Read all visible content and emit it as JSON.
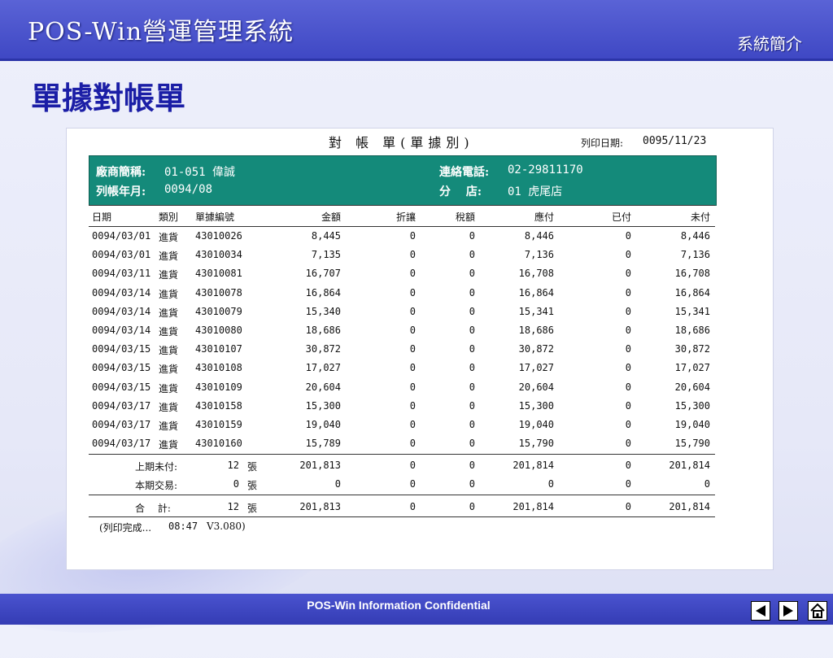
{
  "header": {
    "app_title": "POS-Win營運管理系統",
    "section": "系統簡介"
  },
  "page_heading": "單據對帳單",
  "report": {
    "title": "對 帳 單(單據別)",
    "print_date_label": "列印日期:",
    "print_date": "0095/11/23",
    "vendor_label": "廠商簡稱:",
    "vendor_value": "01-051 偉誠",
    "phone_label": "連絡電話:",
    "phone_value": "02-29811170",
    "period_label": "列帳年月:",
    "period_value": "0094/08",
    "branch_label": "分　 店:",
    "branch_value": "01 虎尾店",
    "columns": [
      "日期",
      "類別",
      "單據編號",
      "金額",
      "折讓",
      "稅額",
      "應付",
      "已付",
      "未付"
    ],
    "rows": [
      [
        "0094/03/01",
        "進貨",
        "43010026",
        "8,445",
        "0",
        "0",
        "8,446",
        "0",
        "8,446"
      ],
      [
        "0094/03/01",
        "進貨",
        "43010034",
        "7,135",
        "0",
        "0",
        "7,136",
        "0",
        "7,136"
      ],
      [
        "0094/03/11",
        "進貨",
        "43010081",
        "16,707",
        "0",
        "0",
        "16,708",
        "0",
        "16,708"
      ],
      [
        "0094/03/14",
        "進貨",
        "43010078",
        "16,864",
        "0",
        "0",
        "16,864",
        "0",
        "16,864"
      ],
      [
        "0094/03/14",
        "進貨",
        "43010079",
        "15,340",
        "0",
        "0",
        "15,341",
        "0",
        "15,341"
      ],
      [
        "0094/03/14",
        "進貨",
        "43010080",
        "18,686",
        "0",
        "0",
        "18,686",
        "0",
        "18,686"
      ],
      [
        "0094/03/15",
        "進貨",
        "43010107",
        "30,872",
        "0",
        "0",
        "30,872",
        "0",
        "30,872"
      ],
      [
        "0094/03/15",
        "進貨",
        "43010108",
        "17,027",
        "0",
        "0",
        "17,027",
        "0",
        "17,027"
      ],
      [
        "0094/03/15",
        "進貨",
        "43010109",
        "20,604",
        "0",
        "0",
        "20,604",
        "0",
        "20,604"
      ],
      [
        "0094/03/17",
        "進貨",
        "43010158",
        "15,300",
        "0",
        "0",
        "15,300",
        "0",
        "15,300"
      ],
      [
        "0094/03/17",
        "進貨",
        "43010159",
        "19,040",
        "0",
        "0",
        "19,040",
        "0",
        "19,040"
      ],
      [
        "0094/03/17",
        "進貨",
        "43010160",
        "15,789",
        "0",
        "0",
        "15,790",
        "0",
        "15,790"
      ]
    ],
    "summary": [
      {
        "label": "上期未付:",
        "count": "12",
        "unit": "張",
        "values": [
          "201,813",
          "0",
          "0",
          "201,814",
          "0",
          "201,814"
        ]
      },
      {
        "label": "本期交易:",
        "count": "0",
        "unit": "張",
        "values": [
          "0",
          "0",
          "0",
          "0",
          "0",
          "0"
        ]
      }
    ],
    "total": {
      "label": "合　 計:",
      "count": "12",
      "unit": "張",
      "values": [
        "201,813",
        "0",
        "0",
        "201,814",
        "0",
        "201,814"
      ]
    },
    "status": "(列印完成...",
    "status_time": "08:47",
    "status_version": "V3.080)"
  },
  "footer": {
    "confidential": "POS-Win Information Confidential"
  },
  "nav": {
    "prev_icon": "triangle-left-icon",
    "next_icon": "triangle-right-icon",
    "home_icon": "home-icon"
  },
  "colors": {
    "header": "#4650cc",
    "heading": "#1b1ea6",
    "infobox": "#148a7a"
  }
}
